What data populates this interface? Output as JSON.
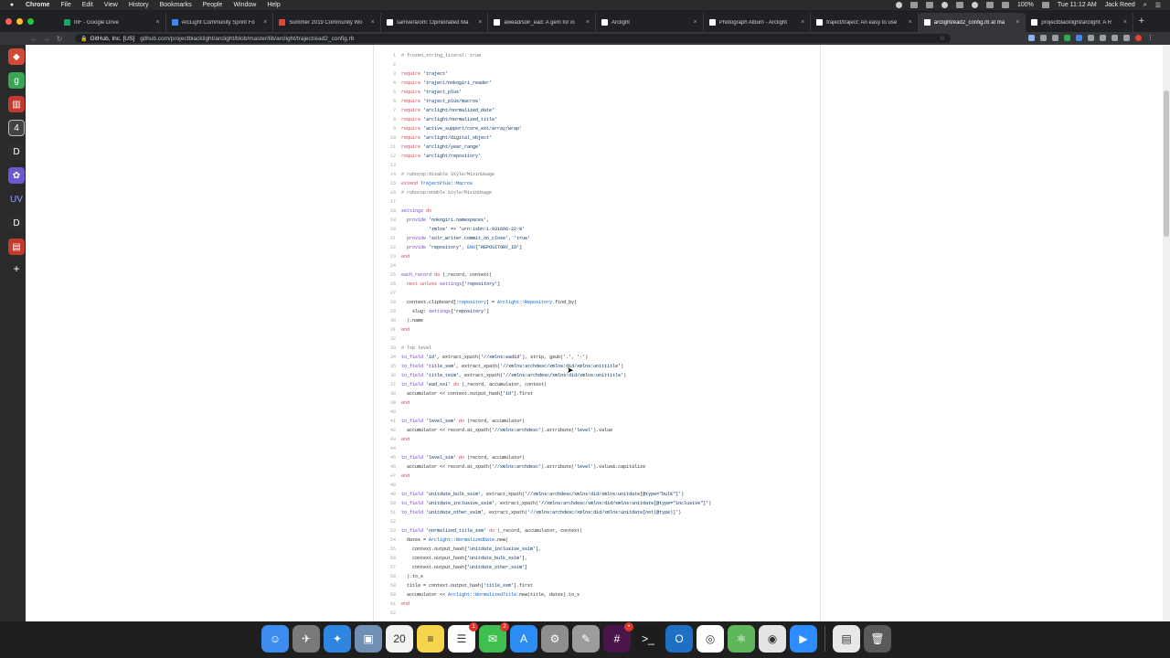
{
  "menubar": {
    "app": "Chrome",
    "items": [
      "File",
      "Edit",
      "View",
      "History",
      "Bookmarks",
      "People",
      "Window",
      "Help"
    ],
    "battery": "100%",
    "clock": "Tue 11:12 AM",
    "user": "Jack Reed"
  },
  "tabs": [
    {
      "title": "IIIF - Google Drive",
      "color": "#1fa463"
    },
    {
      "title": "ArcLight Community Sprint Fo",
      "color": "#4285f4"
    },
    {
      "title": "Summer 2019 Community Wo",
      "color": "#ea4335"
    },
    {
      "title": "samvera/om: Opinionated Ma",
      "color": "#ffffff"
    },
    {
      "title": "awead/solr_ead: A gem for in",
      "color": "#ffffff"
    },
    {
      "title": "Arclight",
      "color": "#ffffff"
    },
    {
      "title": "Photograph Album - Arclight",
      "color": "#ffffff"
    },
    {
      "title": "traject/traject: An easy to use",
      "color": "#ffffff"
    },
    {
      "title": "arclight/ead2_config.rb at ma",
      "color": "#ffffff"
    },
    {
      "title": "projectblacklight/arclight: A R",
      "color": "#ffffff"
    }
  ],
  "toolbar": {
    "origin": "GitHub, Inc. [US]",
    "url": "github.com/projectblacklight/arclight/blob/master/lib/arclight/traject/ead2_config.rb"
  },
  "code": [
    {
      "n": "1",
      "t": "# frozen_string_literal: true"
    },
    {
      "n": "2",
      "t": ""
    },
    {
      "n": "3",
      "t": "require 'traject'"
    },
    {
      "n": "4",
      "t": "require 'traject/nokogiri_reader'"
    },
    {
      "n": "5",
      "t": "require 'traject_plus'"
    },
    {
      "n": "6",
      "t": "require 'traject_plus/macros'"
    },
    {
      "n": "7",
      "t": "require 'arclight/normalized_date'"
    },
    {
      "n": "8",
      "t": "require 'arclight/normalized_title'"
    },
    {
      "n": "9",
      "t": "require 'active_support/core_ext/array/wrap'"
    },
    {
      "n": "10",
      "t": "require 'arclight/digital_object'"
    },
    {
      "n": "11",
      "t": "require 'arclight/year_range'"
    },
    {
      "n": "12",
      "t": "require 'arclight/repository'"
    },
    {
      "n": "13",
      "t": ""
    },
    {
      "n": "14",
      "t": "# rubocop:disable Style/MixinUsage"
    },
    {
      "n": "15",
      "t": "extend TrajectPlus::Macros"
    },
    {
      "n": "16",
      "t": "# rubocop:enable Style/MixinUsage"
    },
    {
      "n": "17",
      "t": ""
    },
    {
      "n": "18",
      "t": "settings do"
    },
    {
      "n": "19",
      "t": "  provide 'nokogiri.namespaces',"
    },
    {
      "n": "20",
      "t": "          'xmlns' => 'urn:isbn:1-931666-22-9'"
    },
    {
      "n": "21",
      "t": "  provide 'solr_writer.commit_on_close', 'true'"
    },
    {
      "n": "22",
      "t": "  provide 'repository', ENV['REPOSITORY_ID']"
    },
    {
      "n": "23",
      "t": "end"
    },
    {
      "n": "24",
      "t": ""
    },
    {
      "n": "25",
      "t": "each_record do |_record, context|"
    },
    {
      "n": "26",
      "t": "  next unless settings['repository']"
    },
    {
      "n": "27",
      "t": ""
    },
    {
      "n": "28",
      "t": "  context.clipboard[:repository] = Arclight::Repository.find_by("
    },
    {
      "n": "29",
      "t": "    slug: settings['repository']"
    },
    {
      "n": "30",
      "t": "  ).name"
    },
    {
      "n": "31",
      "t": "end"
    },
    {
      "n": "32",
      "t": ""
    },
    {
      "n": "33",
      "t": "# Top level"
    },
    {
      "n": "34",
      "t": "to_field 'id', extract_xpath('//xmlns:eadid'), strip, gsub('.', '-')"
    },
    {
      "n": "35",
      "t": "to_field 'title_ssm', extract_xpath('//xmlns:archdesc/xmlns:did/xmlns:unittitle')"
    },
    {
      "n": "36",
      "t": "to_field 'title_teim', extract_xpath('//xmlns:archdesc/xmlns:did/xmlns:unittitle')"
    },
    {
      "n": "37",
      "t": "to_field 'ead_ssi' do |_record, accumulator, context|"
    },
    {
      "n": "38",
      "t": "  accumulator << context.output_hash['id'].first"
    },
    {
      "n": "39",
      "t": "end"
    },
    {
      "n": "40",
      "t": ""
    },
    {
      "n": "41",
      "t": "to_field 'level_ssm' do |record, accumulator|"
    },
    {
      "n": "42",
      "t": "  accumulator << record.at_xpath('//xmlns:archdesc').attribute('level').value"
    },
    {
      "n": "43",
      "t": "end"
    },
    {
      "n": "44",
      "t": ""
    },
    {
      "n": "45",
      "t": "to_field 'level_sim' do |record, accumulator|"
    },
    {
      "n": "46",
      "t": "  accumulator << record.at_xpath('//xmlns:archdesc').attribute('level').value&.capitalize"
    },
    {
      "n": "47",
      "t": "end"
    },
    {
      "n": "48",
      "t": ""
    },
    {
      "n": "49",
      "t": "to_field 'unitdate_bulk_ssim', extract_xpath('//xmlns:archdesc/xmlns:did/xmlns:unitdate[@type=\"bulk\"]')"
    },
    {
      "n": "50",
      "t": "to_field 'unitdate_inclusive_ssim', extract_xpath('//xmlns:archdesc/xmlns:did/xmlns:unitdate[@type=\"inclusive\"]')"
    },
    {
      "n": "51",
      "t": "to_field 'unitdate_other_ssim', extract_xpath('//xmlns:archdesc/xmlns:did/xmlns:unitdate[not(@type)]')"
    },
    {
      "n": "52",
      "t": ""
    },
    {
      "n": "53",
      "t": "to_field 'normalized_title_ssm' do |_record, accumulator, context|"
    },
    {
      "n": "54",
      "t": "  dates = Arclight::NormalizedDate.new("
    },
    {
      "n": "55",
      "t": "    context.output_hash['unitdate_inclusive_ssim'],"
    },
    {
      "n": "56",
      "t": "    context.output_hash['unitdate_bulk_ssim'],"
    },
    {
      "n": "57",
      "t": "    context.output_hash['unitdate_other_ssim']"
    },
    {
      "n": "58",
      "t": "  ).to_s"
    },
    {
      "n": "59",
      "t": "  title = context.output_hash['title_ssm'].first"
    },
    {
      "n": "60",
      "t": "  accumulator << Arclight::NormalizedTitle.new(title, dates).to_s"
    },
    {
      "n": "61",
      "t": "end"
    },
    {
      "n": "62",
      "t": ""
    }
  ],
  "dock": [
    {
      "name": "finder-icon",
      "color": "#3d8cf0",
      "glyph": "☺"
    },
    {
      "name": "launchpad-icon",
      "color": "#7a7a7a",
      "glyph": "✈"
    },
    {
      "name": "safari-icon",
      "color": "#2f86e0",
      "glyph": "✦"
    },
    {
      "name": "preview-icon",
      "color": "#6f8fb3",
      "glyph": "▣"
    },
    {
      "name": "calendar-icon",
      "color": "#f2f2f2",
      "glyph": "20"
    },
    {
      "name": "notes-icon",
      "color": "#f6d54a",
      "glyph": "≡"
    },
    {
      "name": "reminders-icon",
      "color": "#ffffff",
      "glyph": "☰",
      "badge": "1"
    },
    {
      "name": "messages-icon",
      "color": "#3fbf4f",
      "glyph": "✉",
      "badge": "2"
    },
    {
      "name": "app-store-icon",
      "color": "#2b8cf3",
      "glyph": "A"
    },
    {
      "name": "system-preferences-icon",
      "color": "#8e8e8e",
      "glyph": "⚙"
    },
    {
      "name": "script-editor-icon",
      "color": "#9c9c9c",
      "glyph": "✎"
    },
    {
      "name": "slack-icon",
      "color": "#4a154b",
      "glyph": "#",
      "badge": "•"
    },
    {
      "name": "terminal-icon",
      "color": "#1d1d1d",
      "glyph": ">_"
    },
    {
      "name": "outlook-icon",
      "color": "#1f6fc5",
      "glyph": "O"
    },
    {
      "name": "globalprotect-icon",
      "color": "#ffffff",
      "glyph": "◎"
    },
    {
      "name": "atom-icon",
      "color": "#5fb65b",
      "glyph": "⚛"
    },
    {
      "name": "chrome-icon",
      "color": "#e4e4e4",
      "glyph": "◉"
    },
    {
      "name": "zoom-icon",
      "color": "#2d8cff",
      "glyph": "▶"
    },
    {
      "name": "documents-icon",
      "color": "#e8e8e8",
      "glyph": "▤"
    },
    {
      "name": "trash-icon",
      "color": "#5a5a5a",
      "glyph": "🗑"
    }
  ]
}
